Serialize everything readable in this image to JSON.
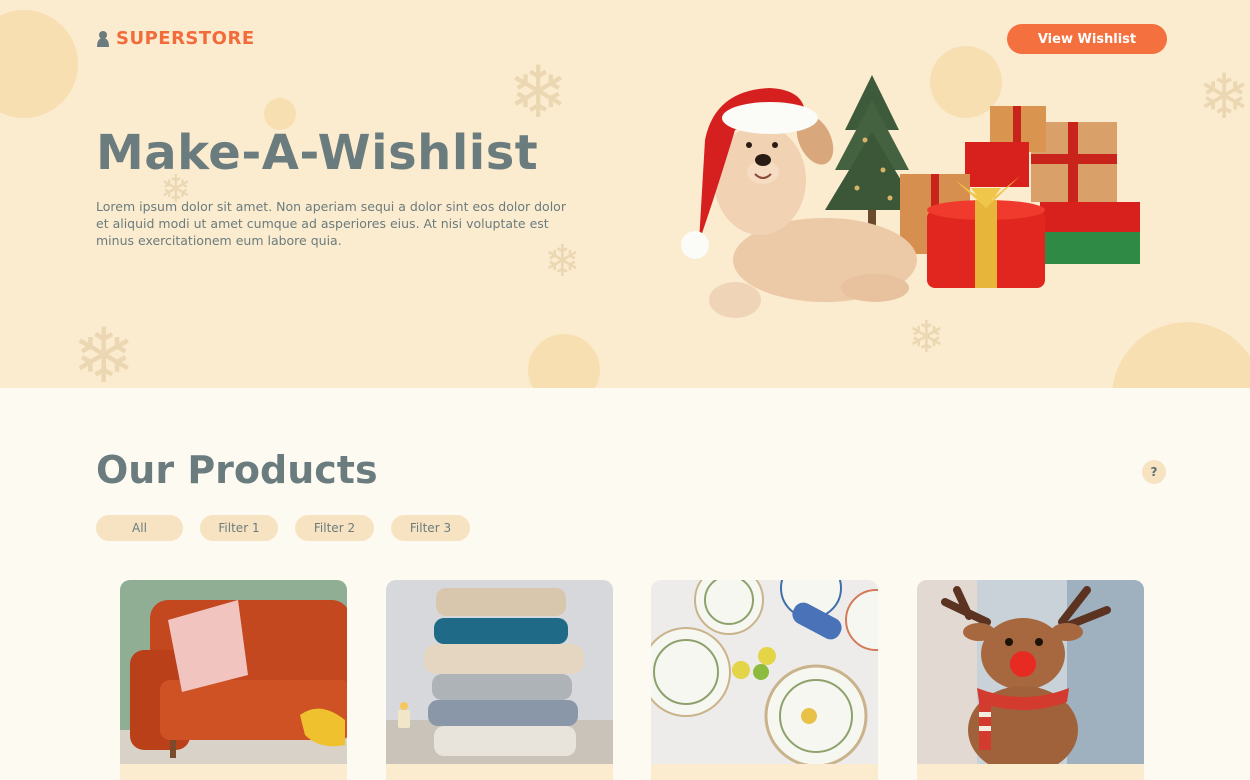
{
  "header": {
    "logo_text": "SUPERSTORE",
    "wishlist_button": "View Wishlist"
  },
  "hero": {
    "title": "Make-A-Wishlist",
    "description": "Lorem ipsum dolor sit amet. Non aperiam sequi a dolor sint eos dolor dolor et aliquid modi ut amet cumque ad asperiores eius. At nisi voluptate est minus exercitationem eum labore quia."
  },
  "products": {
    "title": "Our Products",
    "help_label": "?",
    "filters": [
      "All",
      "Filter 1",
      "Filter 2",
      "Filter 3"
    ],
    "items": [
      {
        "icon": "orange-sofa-image"
      },
      {
        "icon": "folded-blankets-image"
      },
      {
        "icon": "ceramic-plates-image"
      },
      {
        "icon": "reindeer-plush-image"
      }
    ]
  },
  "colors": {
    "accent": "#f4703f",
    "hero_bg": "#fbebcf",
    "page_bg": "#fdfaf2",
    "text": "#6b7c7e",
    "chip_bg": "#f7e3c1"
  }
}
